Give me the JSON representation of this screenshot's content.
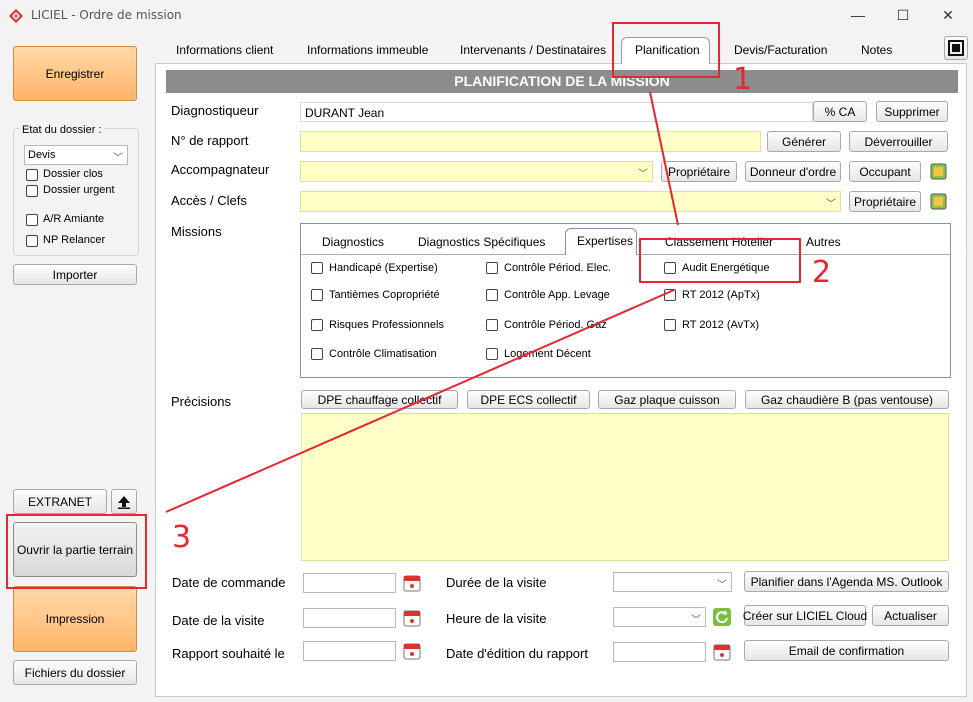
{
  "window": {
    "title": "LICIEL - Ordre de mission",
    "minimize": "—",
    "maximize": "☐",
    "close": "✕"
  },
  "sidebar": {
    "save_label": "Enregistrer",
    "folder_state_label": "Etat du dossier :",
    "folder_state_value": "Devis",
    "closed_label": "Dossier clos",
    "urgent_label": "Dossier urgent",
    "ar_amiante_label": "A/R Amiante",
    "np_relancer_label": "NP Relancer",
    "import_label": "Importer",
    "extranet_label": "EXTRANET",
    "open_field_label": "Ouvrir la partie terrain",
    "print_label": "Impression",
    "files_label": "Fichiers du dossier"
  },
  "tabs": [
    "Informations client",
    "Informations immeuble",
    "Intervenants / Destinataires",
    "Planification",
    "Devis/Facturation",
    "Notes"
  ],
  "section_title": "PLANIFICATION DE LA MISSION",
  "form": {
    "diagnosticien_label": "Diagnostiqueur",
    "diagnosticien_value": "DURANT Jean",
    "pct_ca_label": "% CA",
    "delete_label": "Supprimer",
    "report_no_label": "N° de rapport",
    "generate_label": "Générer",
    "unlock_label": "Déverrouiller",
    "accompagnateur_label": "Accompagnateur",
    "owner_label": "Propriétaire",
    "orderer_label": "Donneur d'ordre",
    "occupant_label": "Occupant",
    "access_label": "Accès / Clefs",
    "owner2_label": "Propriétaire",
    "missions_label": "Missions"
  },
  "mission_tabs": [
    "Diagnostics",
    "Diagnostics Spécifiques",
    "Expertises",
    "Classement Hôtelier",
    "Autres"
  ],
  "expertises": [
    "Handicapé (Expertise)",
    "Contrôle Périod. Elec.",
    "Audit Energétique",
    "Tantièmes Copropriété",
    "Contrôle App. Levage",
    "RT 2012 (ApTx)",
    "Risques Professionnels",
    "Contrôle Périod. Gaz",
    "RT 2012 (AvTx)",
    "Contrôle Climatisation",
    "Logement Décent"
  ],
  "precisions": {
    "label": "Précisions",
    "buttons": [
      "DPE chauffage collectif",
      "DPE ECS collectif",
      "Gaz plaque cuisson",
      "Gaz chaudière B (pas ventouse)"
    ]
  },
  "dates": {
    "order_date_label": "Date de commande",
    "visit_date_label": "Date de la visite",
    "report_wish_label": "Rapport souhaité le",
    "visit_duration_label": "Durée de la visite",
    "visit_time_label": "Heure de la visite",
    "report_edit_label": "Date d'édition du rapport",
    "outlook_label": "Planifier dans l'Agenda MS. Outlook",
    "cloud_label": "Créer sur LICIEL Cloud",
    "refresh_label": "Actualiser",
    "email_label": "Email de confirmation"
  },
  "annotations": {
    "n1": "1",
    "n2": "2",
    "n3": "3"
  },
  "colors": {
    "accent_red": "#e8262d",
    "field_yellow": "#ffffc6",
    "header_gray": "#8c8c8c",
    "orange": "#ffb469"
  }
}
